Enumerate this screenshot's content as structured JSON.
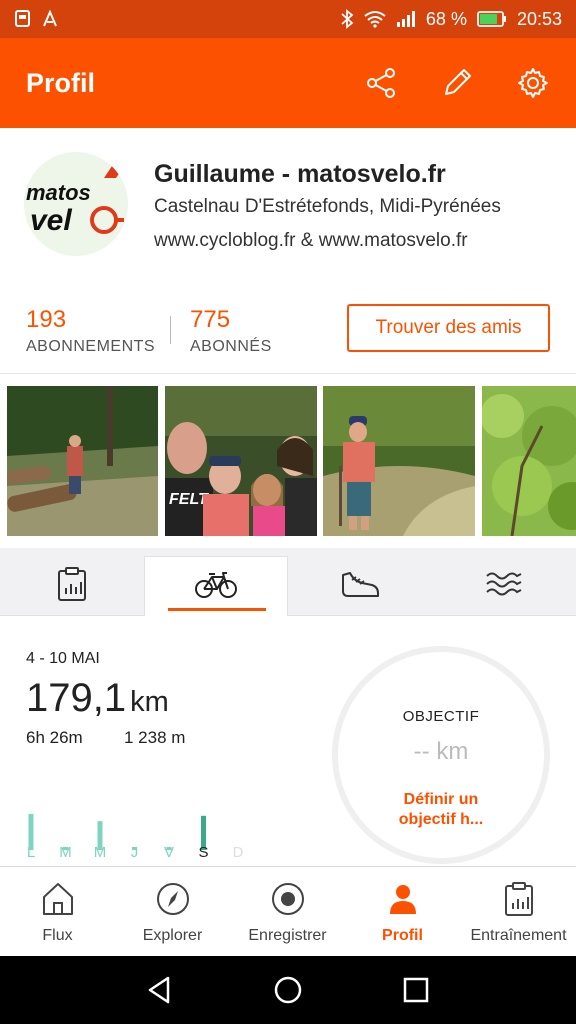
{
  "status_bar": {
    "battery_percent": "68 %",
    "time": "20:53"
  },
  "app_bar": {
    "title": "Profil",
    "icons": [
      "share-icon",
      "edit-icon",
      "settings-icon"
    ]
  },
  "profile": {
    "name": "Guillaume - matosvelo.fr",
    "location": "Castelnau D'Estrétefonds, Midi-Pyrénées",
    "website": "www.cycloblog.fr & www.matosvelo.fr"
  },
  "counts": {
    "following_value": "193",
    "following_label": "ABONNEMENTS",
    "followers_value": "775",
    "followers_label": "ABONNÉS",
    "find_friends": "Trouver des amis"
  },
  "activity_tabs": [
    "clipboard-chart-icon",
    "bike-icon",
    "shoe-icon",
    "swim-icon"
  ],
  "stats": {
    "week": "4 - 10 MAI",
    "distance": "179,1",
    "distance_unit": "km",
    "time": "6h 26m",
    "elevation": "1 238 m",
    "day_labels": [
      "L",
      "M",
      "M",
      "J",
      "V",
      "S",
      "D"
    ],
    "daily_relative": [
      1.0,
      0.15,
      0.8,
      0.15,
      0.15,
      0.95,
      0
    ],
    "goal_title": "OBJECTIF",
    "goal_value": "-- km",
    "goal_link": "Définir un objectif h..."
  },
  "bottom_nav": [
    {
      "label": "Flux",
      "icon": "home-icon"
    },
    {
      "label": "Explorer",
      "icon": "compass-icon"
    },
    {
      "label": "Enregistrer",
      "icon": "record-icon"
    },
    {
      "label": "Profil",
      "icon": "person-icon"
    },
    {
      "label": "Entraînement",
      "icon": "clipboard-chart-icon"
    }
  ],
  "colors": {
    "accent": "#fc5200",
    "status_bar": "#d4430c",
    "bar_teal": "#7fd4c0",
    "bar_teal_dark": "#3aa98a"
  }
}
